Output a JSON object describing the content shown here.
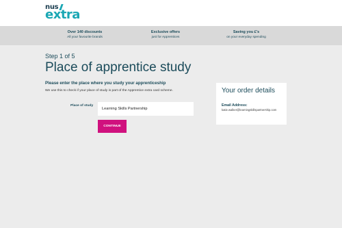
{
  "header": {
    "logo_top": "nus",
    "logo_bottom": "extra"
  },
  "benefits": [
    {
      "title": "Over 140 discounts",
      "subtitle": "All your favourite brands"
    },
    {
      "title": "Exclusive offers",
      "subtitle": "just for Apprentices"
    },
    {
      "title": "Saving you £'s",
      "subtitle": "on your everyday spending"
    }
  ],
  "main": {
    "step": "Step 1 of 5",
    "title": "Place of apprentice study",
    "subheading": "Please enter the place where you study your apprenticeship",
    "description": "We use this to check if your place of study is part of the Apprentice extra card scheme.",
    "field_label": "Place of study",
    "field_value": "Learning Skills Partnership",
    "continue_label": "CONTINUE"
  },
  "order": {
    "heading": "Your order details",
    "email_label": "Email Address:",
    "email_value": "katie.walker@learningskillspartnership.com"
  },
  "colors": {
    "accent": "#1aa7b4",
    "button": "#d0117e",
    "text": "#1b4b5a"
  }
}
